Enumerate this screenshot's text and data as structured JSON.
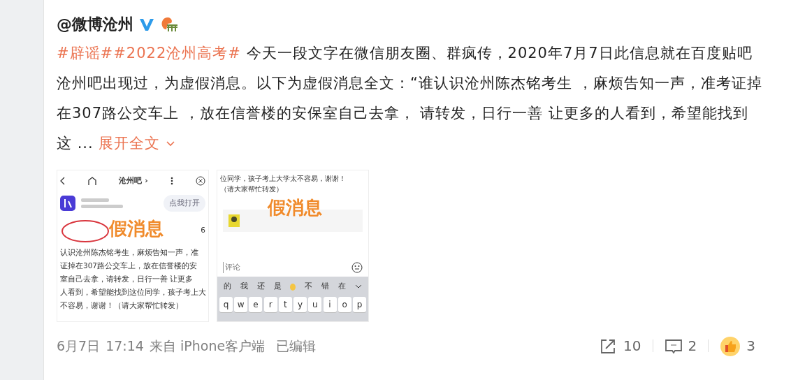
{
  "post": {
    "author": "@微博沧州",
    "verified": true,
    "body": [
      {
        "kind": "topic",
        "text": "#辟谣#"
      },
      {
        "kind": "topic",
        "text": "#2022沧州高考#"
      },
      {
        "kind": "plain",
        "text": " 今天一段文字在微信朋友圈、群疯传，2020年7月7日此信息就在百度贴吧沧州吧出现过，为虚假消息。以下为虚假消息全文：“谁认识沧州陈杰铭考生 ，麻烦告知一声，准考证掉在307路公交车上 ，放在信誉楼的安保室自己去拿， 请转发，日行一善 让更多的人看到，希望能找到这 ... "
      },
      {
        "kind": "expand",
        "text": "展开全文"
      }
    ],
    "images": [
      {
        "kind": "tieba",
        "title": "沧州吧 ›",
        "open_button": "点我打开",
        "stamp": "假消息",
        "side_number": "6",
        "lines": [
          "认识沧州陈杰铭考生，麻烦告知一声，准",
          "证掉在307路公交车上，放在信誉楼的安",
          "室自己去拿，请转发，日行一善 让更多",
          "人看到，希望能找到这位同学，孩子考上大",
          "不容易，谢谢！（请大家帮忙转发）"
        ]
      },
      {
        "kind": "chat",
        "lines": [
          "位同学，孩子考上大学太不容易，谢谢！",
          "（请大家帮忙转发）"
        ],
        "stamp": "假消息",
        "input_placeholder": "评论",
        "candidates": [
          "的",
          "我",
          "还",
          "是",
          "不",
          "错",
          "在"
        ],
        "keys": [
          "q",
          "w",
          "e",
          "r",
          "t",
          "y",
          "u",
          "i",
          "o",
          "p"
        ]
      }
    ],
    "meta": {
      "date": "6月7日",
      "time": "17:14",
      "source": "来自 iPhone客户端",
      "edited": "已编辑"
    },
    "actions": [
      {
        "kind": "share",
        "count": "10"
      },
      {
        "kind": "comment",
        "count": "2"
      },
      {
        "kind": "like",
        "count": "3",
        "liked": true
      }
    ]
  }
}
